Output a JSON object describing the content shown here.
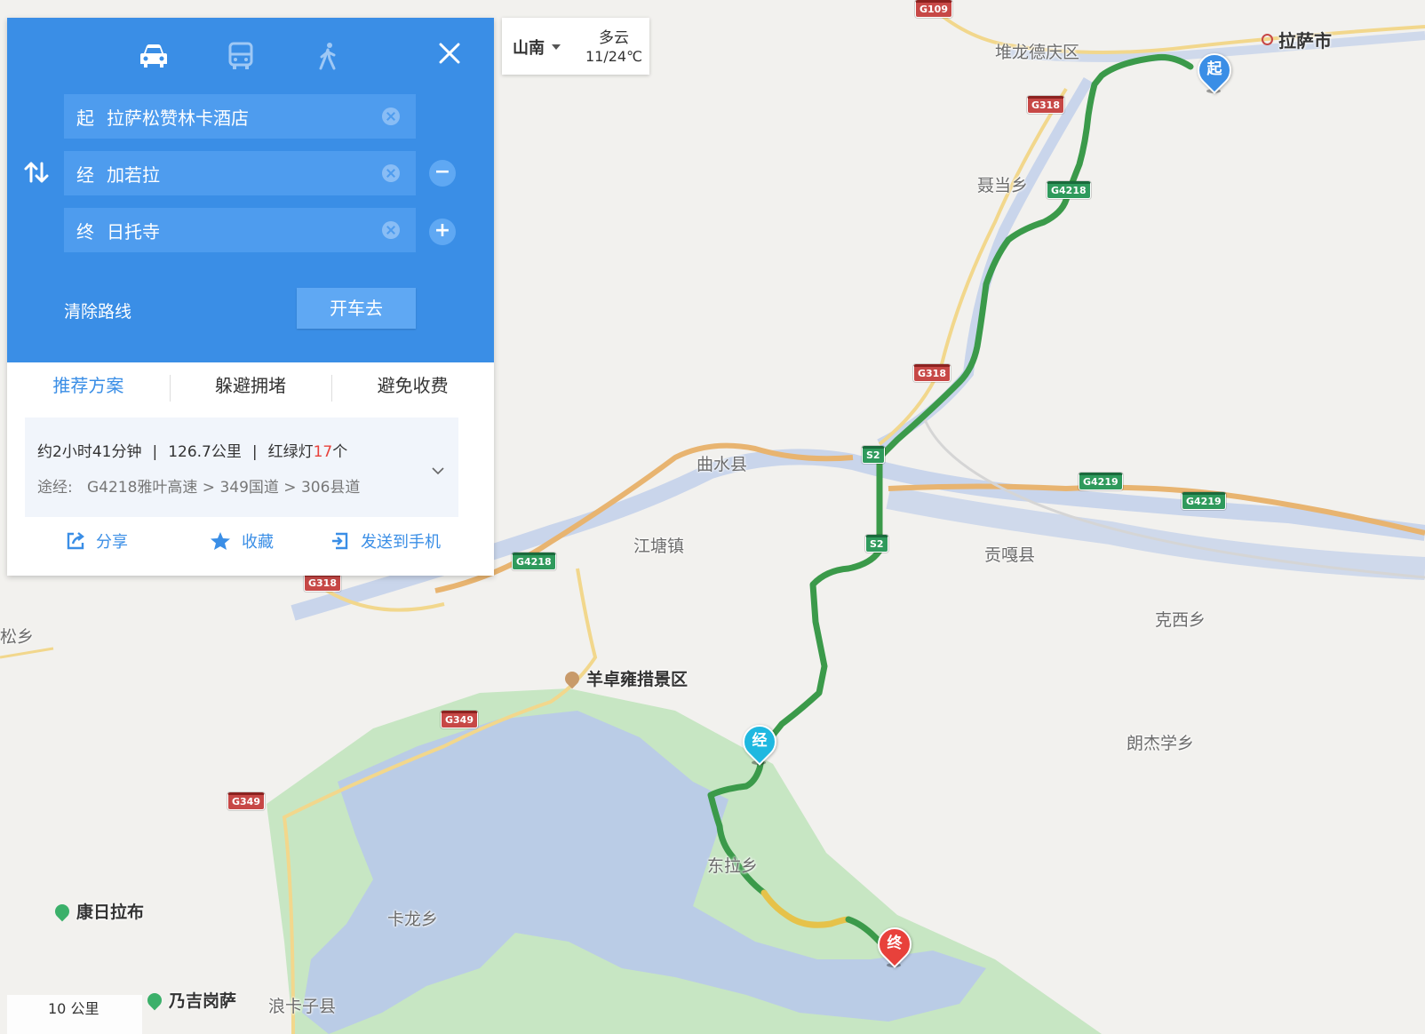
{
  "panel": {
    "modes": [
      "drive-icon",
      "bus-icon",
      "walk-icon"
    ],
    "start_tag": "起",
    "start": "拉萨松赞林卡酒店",
    "via_tag": "经",
    "via": "加若拉",
    "end_tag": "终",
    "end": "日托寺",
    "minus": "−",
    "plus": "+",
    "clear_route": "清除路线",
    "go": "开车去",
    "tabs": [
      "推荐方案",
      "躲避拥堵",
      "避免收费"
    ],
    "route": {
      "time": "约2小时41分钟",
      "distance": "126.7公里",
      "lights_prefix": "红绿灯",
      "lights_count": "17",
      "lights_suffix": "个",
      "via_label": "途经:",
      "roads": [
        "G4218雅叶高速",
        "349国道",
        "306县道"
      ]
    },
    "actions": {
      "share": "分享",
      "favorite": "收藏",
      "send": "发送到手机"
    }
  },
  "weather": {
    "city": "山南",
    "condition": "多云",
    "temp": "11/24℃"
  },
  "scale": "10 公里",
  "map_labels": {
    "lhasa": "拉萨市",
    "duilongdeqing": "堆龙德庆区",
    "niedang": "聂当乡",
    "qushui": "曲水县",
    "jiangtang": "江塘镇",
    "gongga": "贡嘎县",
    "kexi": "克西乡",
    "yamdrok": "羊卓雍措景区",
    "langjiexue": "朗杰学乡",
    "dongla": "东拉乡",
    "kalong": "卡龙乡",
    "kangrilabu": "康日拉布",
    "naijigangsa": "乃吉岗萨",
    "langkazi": "浪卡子县",
    "song": "松乡"
  },
  "shields": {
    "g109": "G109",
    "g318": "G318",
    "g4218": "G4218",
    "s2": "S2",
    "g4219": "G4219",
    "g349": "G349"
  },
  "markers": {
    "start": "起",
    "via": "经",
    "end": "终"
  },
  "colors": {
    "panel_blue": "#3a8ee6",
    "route_green": "#3b9a4a",
    "route_yellow": "#e6c24a",
    "lake": "#b8c9ea",
    "land_green": "#c7e6c3",
    "road_orange": "#e8b470"
  }
}
